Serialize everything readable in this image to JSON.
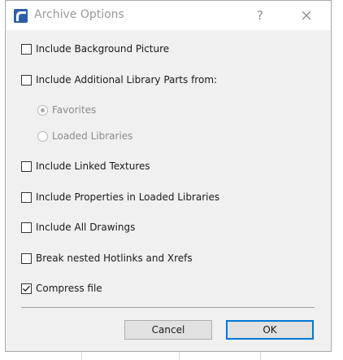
{
  "window": {
    "title": "Archive Options",
    "help_glyph": "?",
    "close_glyph": "✕"
  },
  "options": {
    "background_picture": {
      "label": "Include Background Picture",
      "checked": false
    },
    "additional_library_parts": {
      "label": "Include Additional Library Parts from:",
      "checked": false
    },
    "favorites": {
      "label": "Favorites",
      "selected": true,
      "enabled": false
    },
    "loaded_libraries": {
      "label": "Loaded Libraries",
      "selected": false,
      "enabled": false
    },
    "linked_textures": {
      "label": "Include Linked Textures",
      "checked": false
    },
    "properties_in_loaded_libraries": {
      "label": "Include Properties in Loaded Libraries",
      "checked": false
    },
    "all_drawings": {
      "label": "Include All Drawings",
      "checked": false
    },
    "break_nested_hotlinks": {
      "label": "Break nested Hotlinks and Xrefs",
      "checked": false
    },
    "compress_file": {
      "label": "Compress file",
      "checked": true
    }
  },
  "buttons": {
    "cancel": "Cancel",
    "ok": "OK"
  },
  "colors": {
    "accent": "#0078d7",
    "app_icon": "#2f5fa8"
  }
}
